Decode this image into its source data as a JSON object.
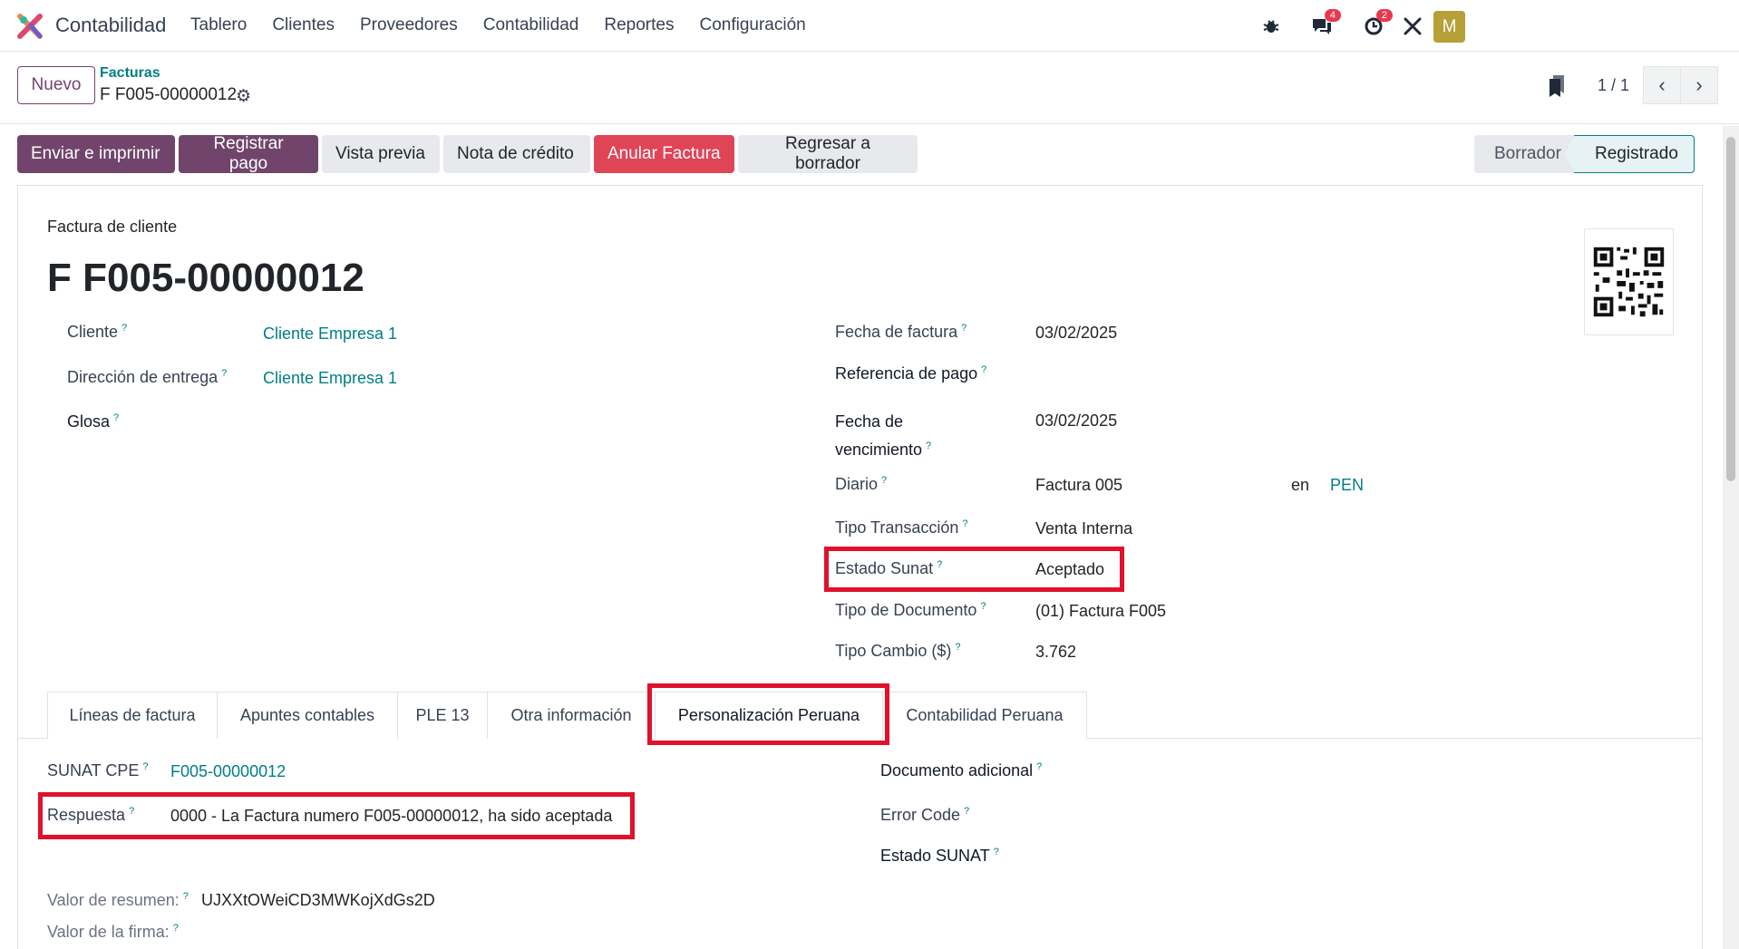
{
  "navbar": {
    "app_name": "Contabilidad",
    "menu": [
      "Tablero",
      "Clientes",
      "Proveedores",
      "Contabilidad",
      "Reportes",
      "Configuración"
    ],
    "messages_badge": "4",
    "activities_badge": "2",
    "avatar_letter": "M"
  },
  "control_panel": {
    "new_label": "Nuevo",
    "breadcrumb_parent": "Facturas",
    "breadcrumb_current": "F F005-00000012",
    "pager": "1 / 1"
  },
  "actions": {
    "send_print": "Enviar e imprimir",
    "register_payment": "Registrar pago",
    "preview": "Vista previa",
    "credit_note": "Nota de crédito",
    "cancel_invoice": "Anular Factura",
    "reset_draft": "Regresar a borrador"
  },
  "status": {
    "draft": "Borrador",
    "posted": "Registrado"
  },
  "form": {
    "doc_type": "Factura de cliente",
    "doc_name": "F F005-00000012",
    "customer_label": "Cliente",
    "customer_value": "Cliente Empresa 1",
    "delivery_label": "Dirección de entrega",
    "delivery_value": "Cliente Empresa 1",
    "glosa_label": "Glosa",
    "invoice_date_label": "Fecha de factura",
    "invoice_date_value": "03/02/2025",
    "payment_ref_label": "Referencia de pago",
    "due_date_label_1": "Fecha de",
    "due_date_label_2": "vencimiento",
    "due_date_value": "03/02/2025",
    "journal_label": "Diario",
    "journal_value": "Factura 005",
    "currency_in": "en",
    "currency_value": "PEN",
    "transaction_label": "Tipo Transacción",
    "transaction_value": "Venta Interna",
    "sunat_state_label": "Estado Sunat",
    "sunat_state_value": "Aceptado",
    "doc_kind_label": "Tipo de Documento",
    "doc_kind_value": "(01) Factura F005",
    "exchange_label": "Tipo Cambio ($)",
    "exchange_value": "3.762",
    "help_mark": "?"
  },
  "tabs": [
    "Líneas de factura",
    "Apuntes contables",
    "PLE 13",
    "Otra información",
    "Personalización Peruana",
    "Contabilidad Peruana"
  ],
  "peru_tab": {
    "cpe_label": "SUNAT CPE",
    "cpe_value": "F005-00000012",
    "response_label": "Respuesta",
    "response_value": "0000 - La Factura numero F005-00000012, ha sido aceptada",
    "additional_doc_label": "Documento adicional",
    "error_code_label": "Error Code",
    "sunat_state_label": "Estado SUNAT",
    "digest_label": "Valor de resumen:",
    "digest_value": "UJXXtOWeiCD3MWKojXdGs2D",
    "signature_label": "Valor de la firma:"
  }
}
